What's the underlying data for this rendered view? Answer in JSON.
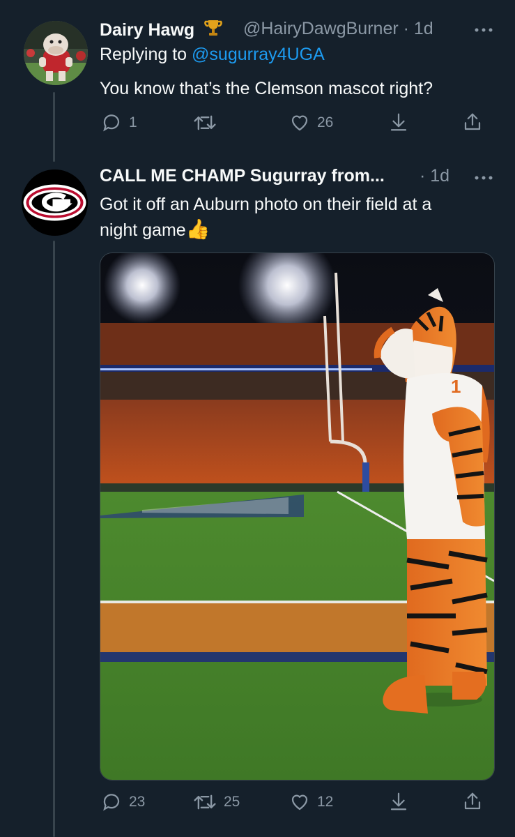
{
  "tweet1": {
    "name": "Dairy Hawg",
    "badge_icon": "trophy-icon",
    "handle": "@HairyDawgBurner",
    "dot": "·",
    "time": "1d",
    "replying_prefix": "Replying to",
    "replying_handle": "@sugurray4UGA",
    "text": "You know that’s the Clemson mascot right?",
    "reply_count": "1",
    "retweet_count": "",
    "like_count": "26"
  },
  "tweet2": {
    "name": "CALL ME CHAMP Sugurray from...",
    "dot": "·",
    "time": "1d",
    "text_line1": "Got it off an Auburn photo on their field at a",
    "text_line2": "night game",
    "emoji": "👍",
    "reply_count": "23",
    "retweet_count": "25",
    "like_count": "12",
    "media_alt_icon": "photo-icon"
  },
  "colors": {
    "background": "#15202b",
    "text": "#f7f9f9",
    "muted": "#8b98a5",
    "link": "#1d9bf0",
    "thread_line": "#38444d"
  }
}
